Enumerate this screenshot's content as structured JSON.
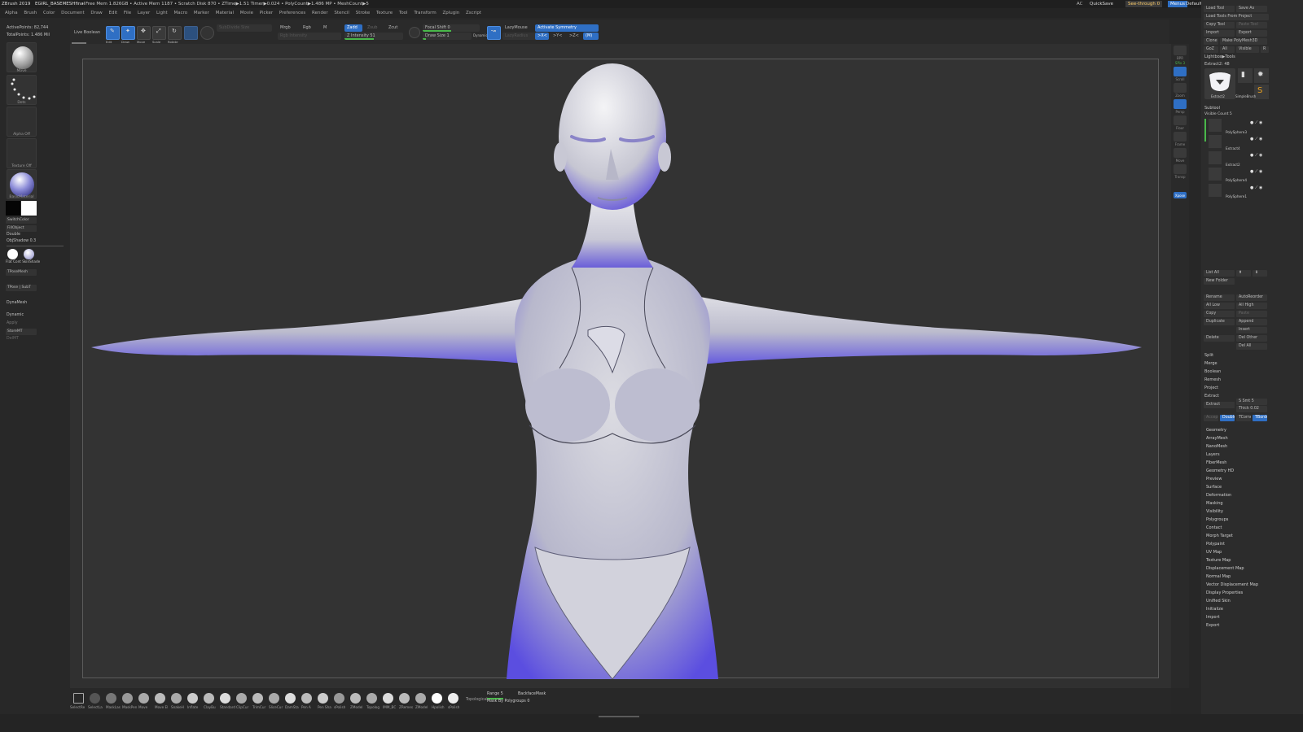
{
  "title_bar": {
    "app": "ZBrush 2019",
    "doc": "EGIRL_BASEMESHfinal",
    "stats": "• Free Mem 1.826GB • Active Mem 1187 • Scratch Disk 870 • ZTime▶1.51 Timer▶0.024 • PolyCount▶1.486 MP • MeshCount▶5",
    "ac": "AC",
    "quicksave": "QuickSave",
    "see_through": "See-through  0",
    "menus_btn": "Menus",
    "script": "DefaultZScript"
  },
  "menus": [
    "Alpha",
    "Brush",
    "Color",
    "Document",
    "Draw",
    "Edit",
    "File",
    "Layer",
    "Light",
    "Macro",
    "Marker",
    "Material",
    "Movie",
    "Picker",
    "Preferences",
    "Render",
    "Stencil",
    "Stroke",
    "Texture",
    "Tool",
    "Transform",
    "Zplugin",
    "Zscript"
  ],
  "left_shelf": {
    "active_points": "ActivePoints: 82,744",
    "total_points": "TotalPoints: 1.486 Mil",
    "brush_caption": "Move",
    "stroke_caption": "Dots",
    "alpha_caption": "Alpha Off",
    "texture_caption": "Texture Off",
    "material_caption": "BasicMaterial",
    "switch_color": "SwitchColor",
    "fill_object": "FillObject",
    "double": "Double",
    "obj_shadow": "ObjShadow 0.3",
    "flat_skin": "Flat Cont  SkinShade",
    "tpose_mesh": "TPoseMesh",
    "tpose_subt": "TPose | SubT",
    "dynamesh": "DynaMesh",
    "dynamic": "Dynamic",
    "apply": "Apply",
    "store_mt": "StoreMT",
    "del_mt": "DelMT"
  },
  "top_shelf": {
    "live_boolean": "Live Boolean",
    "edit": "Edit",
    "draw": "Draw",
    "move": "Move",
    "scale": "Scale",
    "rotate": "Rotate",
    "sub_divide": "SubDivide Size",
    "mrgb": "Mrgb",
    "rgb": "Rgb",
    "m": "M",
    "zadd": "Zadd",
    "zsub": "Zsub",
    "zcut": "Zcut",
    "focal_shift": "Focal Shift 0",
    "draw_size": "Draw Size 1",
    "dynamic": "Dynamic",
    "rgb_intensity": "Rgb Intensity",
    "z_intensity": "Z Intensity 51",
    "lazymouse": "LazyMouse",
    "lazy_radius": "LazyRadius",
    "activate_symmetry": "Activate Symmetry",
    "sym_x": ">X<",
    "sym_y": ">Y<",
    "sym_z": ">Z<",
    "sym_m": "(M)"
  },
  "right_mini": {
    "bpr": "BPR",
    "spix": "SPix 3",
    "scroll": "Scroll",
    "zoom": "Zoom",
    "actual": "Actual",
    "aahalf": "AAHalf",
    "persp": "Persp",
    "floor": "Floor",
    "local": "Local",
    "frame": "Frame",
    "move": "Move",
    "transp": "Transp",
    "xpose": "Xpose"
  },
  "tool_palette": {
    "load_tool": "Load Tool",
    "save_as": "Save As",
    "load_from_project": "Load Tools From Project",
    "copy_tool": "Copy Tool",
    "paste_tool": "Paste Tool",
    "import": "Import",
    "export": "Export",
    "clone": "Clone",
    "make_polymesh": "Make PolyMesh3D",
    "goz": "GoZ",
    "all": "All",
    "visible": "Visible",
    "r": "R",
    "lightbox_tools": "Lightbox▶Tools",
    "extract_label": "Extract2: 48",
    "thumb_extract": "Extract2",
    "thumb_cylinder": "Cylinder3D",
    "thumb_polymesh": "PolyMesh3D",
    "thumb_simple": "SimpleBrush",
    "subtool": "Subtool",
    "visible_count": "Visible Count 5",
    "subtools": [
      "PolySphere3",
      "Extract4",
      "Extract2",
      "PolySphere4",
      "PolySphere1"
    ],
    "list_all": "List All",
    "new_folder": "New Folder",
    "rename": "Rename",
    "auto_reorder": "AutoReorder",
    "all_low": "All Low",
    "all_high": "All High",
    "copy": "Copy",
    "paste": "Paste",
    "duplicate": "Duplicate",
    "append": "Append",
    "insert": "Insert",
    "delete": "Delete",
    "del_other": "Del Other",
    "del_all": "Del All",
    "split": "Split",
    "merge": "Merge",
    "boolean": "Boolean",
    "remesh": "Remesh",
    "project": "Project",
    "extract": "Extract",
    "extract2": "Extract",
    "s_smt": "S Smt 5",
    "thick": "Thick 0.02",
    "accept": "Accept",
    "double": "Double",
    "tcorne": "TCorne",
    "tborder": "TBorde",
    "sections": [
      "Geometry",
      "ArrayMesh",
      "NanoMesh",
      "Layers",
      "FiberMesh",
      "Geometry HD",
      "Preview",
      "Surface",
      "Deformation",
      "Masking",
      "Visibility",
      "Polygroups",
      "Contact",
      "Morph Target",
      "Polypaint",
      "UV Map",
      "Texture Map",
      "Displacement Map",
      "Normal Map",
      "Vector Displacement Map",
      "Display Properties",
      "Unified Skin",
      "Initialize",
      "Import",
      "Export"
    ]
  },
  "bottom_shelf": {
    "brushes": [
      "SelectRe",
      "SelectLa",
      "MaskLas",
      "MaskPen",
      "Move",
      "Move El",
      "SnakeH",
      "Inflate",
      "ClayBu",
      "Standard",
      "ClipCur",
      "TrimCur",
      "SliceCur",
      "DamSta",
      "Pen A",
      "Pen Sha",
      "sPolish",
      "ZModel",
      "Topolog",
      "IMM_BC",
      "ZRemes",
      "ZModel",
      "Hpolish",
      "sPolish",
      "hPolish"
    ],
    "topological": "Topological",
    "range": "Range 5",
    "backface_mask": "BackfaceMask",
    "mask_polygroups": "Mask By Polygroups 0"
  },
  "accent_colors": {
    "blue": "#2f6fc4",
    "green": "#49b84a",
    "sculpt_shade": "#5848d8"
  }
}
